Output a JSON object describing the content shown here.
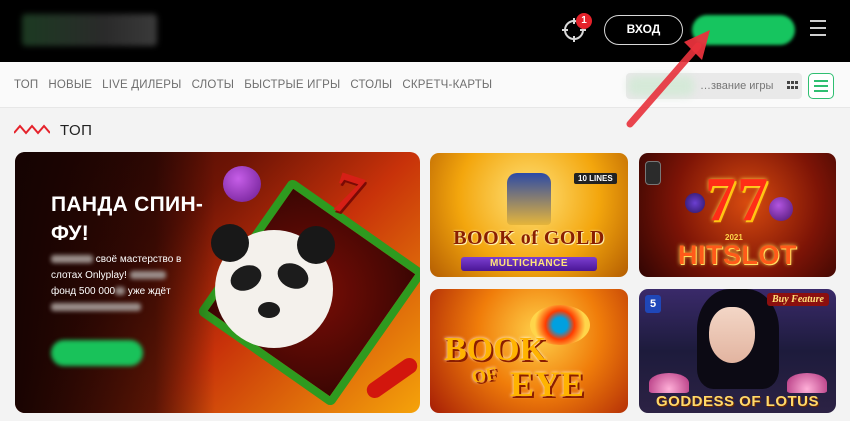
{
  "header": {
    "bonus_badge_count": "1",
    "login_label": "ВХОД",
    "register_label": "",
    "menu_icon": "hamburger-icon",
    "bonus_icon": "target-icon"
  },
  "nav": {
    "items": [
      {
        "label": "ТОП"
      },
      {
        "label": "НОВЫЕ"
      },
      {
        "label": "LIVE ДИЛЕРЫ"
      },
      {
        "label": "СЛОТЫ"
      },
      {
        "label": "БЫСТРЫЕ ИГРЫ"
      },
      {
        "label": "СТОЛЫ"
      },
      {
        "label": "СКРЕТЧ-КАРТЫ"
      }
    ],
    "search_placeholder": "…звание игры",
    "view_icon": "grid-dots-icon",
    "filter_icon": "sliders-icon"
  },
  "section": {
    "title": "ТОП"
  },
  "hero": {
    "title": "ПАНДА СПИН-ФУ!",
    "line1": "своё мастерство в",
    "line2": "слотах Onlyplay!",
    "line3a": "фонд 500 000",
    "line3b": "уже ждёт"
  },
  "games": [
    {
      "title": "BOOK of GOLD",
      "subtitle": "MULTICHANCE",
      "tag": "10 LINES"
    },
    {
      "title": "HITSLOT",
      "year": "2021",
      "digits": "77"
    },
    {
      "title": "BOOK OF EYE",
      "word1": "BOOK",
      "word2": "OF",
      "word3": "EYE"
    },
    {
      "title": "GODDESS OF LOTUS",
      "tag": "Buy Feature",
      "badge": "5"
    }
  ],
  "colors": {
    "header_bg": "#000000",
    "accent_green": "#16c55f",
    "badge_red": "#e5222b",
    "annotation_arrow": "#e8323c"
  }
}
